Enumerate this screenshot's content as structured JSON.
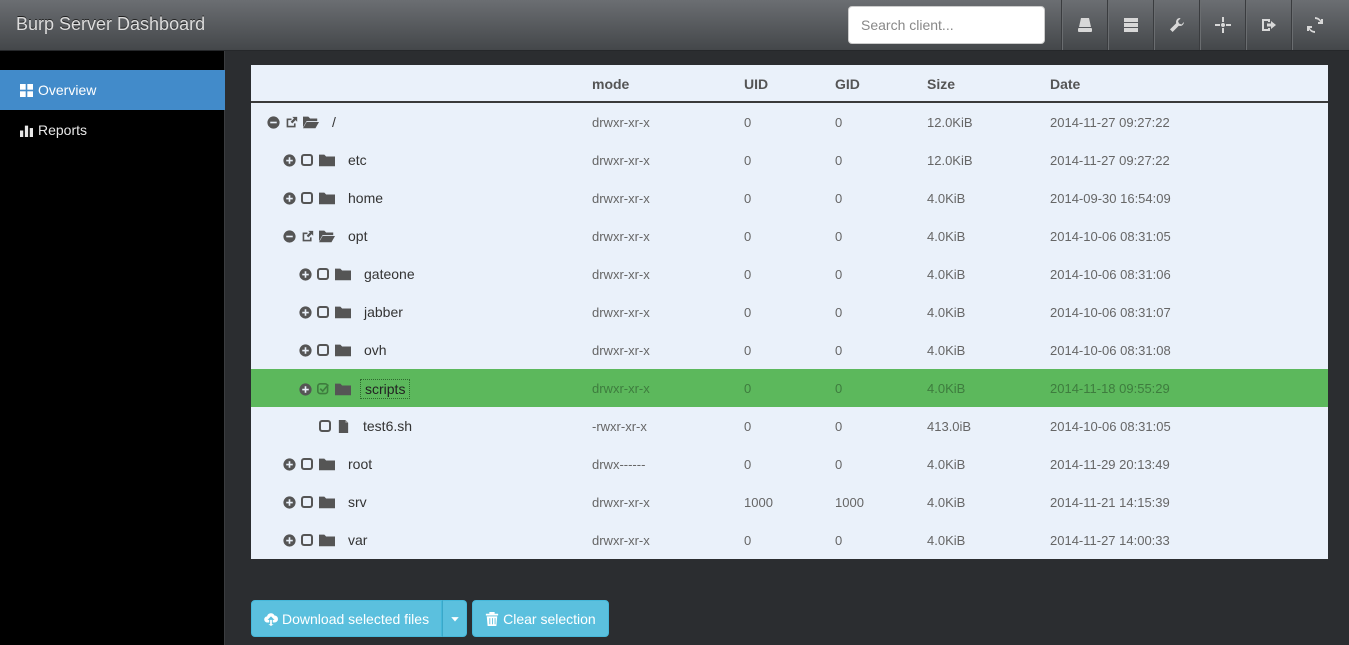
{
  "brand": "Burp Server Dashboard",
  "search": {
    "placeholder": "Search client..."
  },
  "nav_icons": [
    "drive-icon",
    "server-icon",
    "wrench-icon",
    "crosshair-icon",
    "logout-icon",
    "refresh-icon"
  ],
  "sidebar": {
    "items": [
      {
        "label": "Overview",
        "icon": "dashboard-icon",
        "active": true
      },
      {
        "label": "Reports",
        "icon": "chart-icon",
        "active": false
      }
    ]
  },
  "table": {
    "headers": {
      "name": "",
      "mode": "mode",
      "uid": "UID",
      "gid": "GID",
      "size": "Size",
      "date": "Date"
    },
    "rows": [
      {
        "name": "/",
        "mode": "drwxr-xr-x",
        "uid": "0",
        "gid": "0",
        "size": "12.0KiB",
        "date": "2014-11-27 09:27:22"
      },
      {
        "name": "etc",
        "mode": "drwxr-xr-x",
        "uid": "0",
        "gid": "0",
        "size": "12.0KiB",
        "date": "2014-11-27 09:27:22"
      },
      {
        "name": "home",
        "mode": "drwxr-xr-x",
        "uid": "0",
        "gid": "0",
        "size": "4.0KiB",
        "date": "2014-09-30 16:54:09"
      },
      {
        "name": "opt",
        "mode": "drwxr-xr-x",
        "uid": "0",
        "gid": "0",
        "size": "4.0KiB",
        "date": "2014-10-06 08:31:05"
      },
      {
        "name": "gateone",
        "mode": "drwxr-xr-x",
        "uid": "0",
        "gid": "0",
        "size": "4.0KiB",
        "date": "2014-10-06 08:31:06"
      },
      {
        "name": "jabber",
        "mode": "drwxr-xr-x",
        "uid": "0",
        "gid": "0",
        "size": "4.0KiB",
        "date": "2014-10-06 08:31:07"
      },
      {
        "name": "ovh",
        "mode": "drwxr-xr-x",
        "uid": "0",
        "gid": "0",
        "size": "4.0KiB",
        "date": "2014-10-06 08:31:08"
      },
      {
        "name": "scripts",
        "mode": "drwxr-xr-x",
        "uid": "0",
        "gid": "0",
        "size": "4.0KiB",
        "date": "2014-11-18 09:55:29"
      },
      {
        "name": "test6.sh",
        "mode": "-rwxr-xr-x",
        "uid": "0",
        "gid": "0",
        "size": "413.0iB",
        "date": "2014-10-06 08:31:05"
      },
      {
        "name": "root",
        "mode": "drwx------",
        "uid": "0",
        "gid": "0",
        "size": "4.0KiB",
        "date": "2014-11-29 20:13:49"
      },
      {
        "name": "srv",
        "mode": "drwxr-xr-x",
        "uid": "1000",
        "gid": "1000",
        "size": "4.0KiB",
        "date": "2014-11-21 14:15:39"
      },
      {
        "name": "var",
        "mode": "drwxr-xr-x",
        "uid": "0",
        "gid": "0",
        "size": "4.0KiB",
        "date": "2014-11-27 14:00:33"
      }
    ]
  },
  "buttons": {
    "download": "Download selected files",
    "clear": "Clear selection"
  },
  "colors": {
    "selected_row": "#5cb85c",
    "button": "#5bc0de",
    "active_nav": "#428bca"
  }
}
